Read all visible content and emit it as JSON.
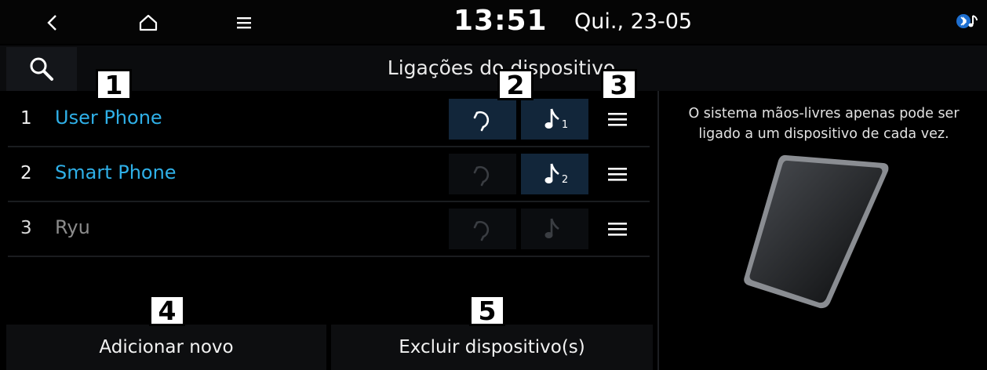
{
  "status_bar": {
    "back_icon": "chevron-left-icon",
    "home_icon": "home-icon",
    "menu_icon": "hamburger-icon",
    "time": "13:51",
    "date": "Qui., 23-05",
    "bluetooth_audio_icon": "bluetooth-audio-icon"
  },
  "header": {
    "search_icon": "search-icon",
    "title": "Ligações do dispositivo"
  },
  "devices": [
    {
      "number": "1",
      "name": "User Phone",
      "handsfree_connected": true,
      "audio_connected": true,
      "audio_badge": "1"
    },
    {
      "number": "2",
      "name": "Smart Phone",
      "handsfree_connected": false,
      "audio_connected": true,
      "audio_badge": "2"
    },
    {
      "number": "3",
      "name": "Ryu",
      "handsfree_connected": false,
      "audio_connected": false,
      "audio_badge": ""
    }
  ],
  "buttons": {
    "add_new": "Adicionar novo",
    "delete_devices": "Excluir dispositivo(s)"
  },
  "info_panel": {
    "text": "O sistema mãos-livres apenas pode ser ligado a um dispositivo de cada vez."
  },
  "callouts": [
    "1",
    "2",
    "3",
    "4",
    "5"
  ],
  "colors": {
    "accent_blue": "#2fb0e8",
    "active_tile": "#12263a",
    "inactive_text": "#8c8c8c"
  }
}
